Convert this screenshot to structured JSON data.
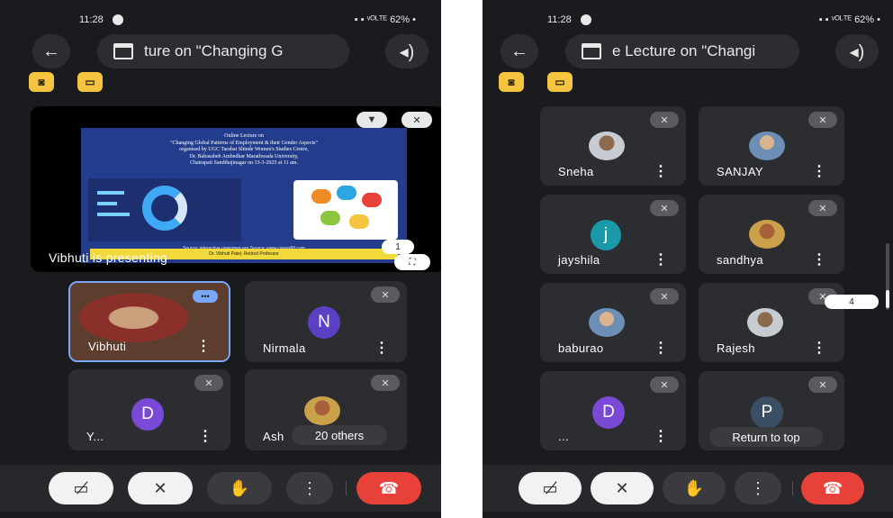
{
  "left": {
    "status": {
      "time": "11:28",
      "right": "▪ ▪ ᵛᴼᴸᵀᴱ 62% •"
    },
    "topbar": {
      "back_icon": "←",
      "title": "ture on \"Changing G",
      "audio_icon": "◂)"
    },
    "badges": [
      "◙",
      "▭"
    ],
    "presentation": {
      "label": "Vibhuti is presenting",
      "pin_icon": "▼",
      "mute_icon": "✕",
      "slide_title": "Online Lecture on\n\"Changing Global Patterns of Employment & their Gender Aspects\"\norganised by UGC Tarabai Shinde Women's Studies Centre,\nDr. Babasaheb Ambedkar Marathwada University,\nChatrapati Sambhajinagar on 13-3-2025 at 11 am.",
      "slide_source": "Source: interactive.unwomen.org              Source: www.career88.com",
      "slide_strip": "Dr. Vibhuti Patel, Retired Professor",
      "page_bubble": "1",
      "expand_icon": "⛶"
    },
    "tiles": [
      {
        "name": "Vibhuti",
        "type": "video"
      },
      {
        "name": "Nirmala",
        "type": "letter",
        "letter": "N",
        "color": "#5b3fc4"
      },
      {
        "name": "Y...",
        "type": "letter",
        "letter": "D",
        "color": "#7a4ad6"
      },
      {
        "name": "Ash",
        "type": "photo",
        "overlay": "20 others"
      }
    ],
    "controls": [
      "▭̸",
      "✕",
      "✋",
      "⋮",
      "☎"
    ]
  },
  "right": {
    "status": {
      "time": "11:28",
      "right": "▪ ▪ ᵛᴼᴸᵀᴱ 62% •"
    },
    "topbar": {
      "back_icon": "←",
      "title": "e Lecture on \"Changi",
      "audio_icon": "◂)"
    },
    "badges": [
      "◙",
      "▭"
    ],
    "tiles": [
      {
        "name": "Sneha",
        "type": "photo",
        "tone": "grey"
      },
      {
        "name": "SANJAY",
        "type": "photo",
        "tone": "blue"
      },
      {
        "name": "jayshila",
        "type": "letter",
        "letter": "j",
        "color": "#1a9aa8"
      },
      {
        "name": "sandhya",
        "type": "photo",
        "tone": "warm"
      },
      {
        "name": "baburao",
        "type": "photo",
        "tone": "blue"
      },
      {
        "name": "Rajesh",
        "type": "photo",
        "tone": "grey"
      },
      {
        "name": "...",
        "type": "letter",
        "letter": "D",
        "color": "#7a4ad6"
      },
      {
        "name": "",
        "type": "letter",
        "letter": "P",
        "color": "#3a4f63",
        "overlay": "Return to top"
      }
    ],
    "page_bubble": "4",
    "controls": [
      "▭̸",
      "✕",
      "✋",
      "⋮",
      "☎"
    ]
  },
  "more_icon": "⋮",
  "mute_icon": "✕",
  "speaking_icon": "•••"
}
